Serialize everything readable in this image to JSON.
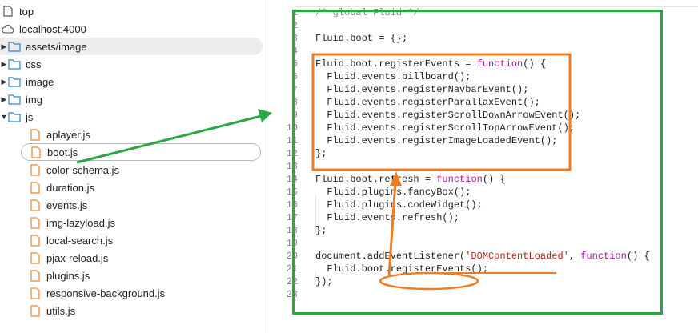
{
  "tree": {
    "items": [
      {
        "label": "top",
        "icon": "document-icon",
        "kind": "root"
      },
      {
        "label": "localhost:4000",
        "icon": "cloud-icon",
        "kind": "origin"
      },
      {
        "label": "assets/image",
        "icon": "folder-icon",
        "kind": "folder"
      },
      {
        "label": "css",
        "icon": "folder-icon",
        "kind": "folder"
      },
      {
        "label": "image",
        "icon": "folder-icon",
        "kind": "folder"
      },
      {
        "label": "img",
        "icon": "folder-icon",
        "kind": "folder"
      },
      {
        "label": "js",
        "icon": "folder-icon",
        "kind": "folder-open"
      },
      {
        "label": "aplayer.js",
        "icon": "js-file-icon",
        "kind": "file"
      },
      {
        "label": "boot.js",
        "icon": "js-file-icon",
        "kind": "file"
      },
      {
        "label": "color-schema.js",
        "icon": "js-file-icon",
        "kind": "file"
      },
      {
        "label": "duration.js",
        "icon": "js-file-icon",
        "kind": "file"
      },
      {
        "label": "events.js",
        "icon": "js-file-icon",
        "kind": "file"
      },
      {
        "label": "img-lazyload.js",
        "icon": "js-file-icon",
        "kind": "file"
      },
      {
        "label": "local-search.js",
        "icon": "js-file-icon",
        "kind": "file"
      },
      {
        "label": "pjax-reload.js",
        "icon": "js-file-icon",
        "kind": "file"
      },
      {
        "label": "plugins.js",
        "icon": "js-file-icon",
        "kind": "file"
      },
      {
        "label": "responsive-background.js",
        "icon": "js-file-icon",
        "kind": "file"
      },
      {
        "label": "utils.js",
        "icon": "js-file-icon",
        "kind": "file"
      }
    ]
  },
  "editor": {
    "lines": [
      {
        "n": "1",
        "text": "/* global Fluid */"
      },
      {
        "n": "2",
        "text": ""
      },
      {
        "n": "3",
        "text": "Fluid.boot = {};"
      },
      {
        "n": "4",
        "text": ""
      },
      {
        "n": "5",
        "text": "Fluid.boot.registerEvents = ",
        "kw": "function",
        "rest": "() {"
      },
      {
        "n": "6",
        "text": "  Fluid.events.billboard();"
      },
      {
        "n": "7",
        "text": "  Fluid.events.registerNavbarEvent();"
      },
      {
        "n": "8",
        "text": "  Fluid.events.registerParallaxEvent();"
      },
      {
        "n": "9",
        "text": "  Fluid.events.registerScrollDownArrowEvent();"
      },
      {
        "n": "10",
        "text": "  Fluid.events.registerScrollTopArrowEvent();"
      },
      {
        "n": "11",
        "text": "  Fluid.events.registerImageLoadedEvent();"
      },
      {
        "n": "12",
        "text": "};"
      },
      {
        "n": "13",
        "text": ""
      },
      {
        "n": "14",
        "text": "Fluid.boot.refresh = ",
        "kw": "function",
        "rest": "() {"
      },
      {
        "n": "15",
        "text": "  Fluid.plugins.fancyBox();"
      },
      {
        "n": "16",
        "text": "  Fluid.plugins.codeWidget();"
      },
      {
        "n": "17",
        "text": "  Fluid.events.refresh();"
      },
      {
        "n": "18",
        "text": "};"
      },
      {
        "n": "19",
        "text": ""
      },
      {
        "n": "20",
        "text": "document.addEventListener(",
        "str": "'DOMContentLoaded'",
        "mid": ", ",
        "kw": "function",
        "rest": "() {"
      },
      {
        "n": "21",
        "text": "  Fluid.boot.registerEvents();"
      },
      {
        "n": "22",
        "text": "});"
      },
      {
        "n": "23",
        "text": ""
      }
    ]
  },
  "annotation": {
    "green_color": "#2aa745",
    "orange_color": "#f07c22"
  }
}
